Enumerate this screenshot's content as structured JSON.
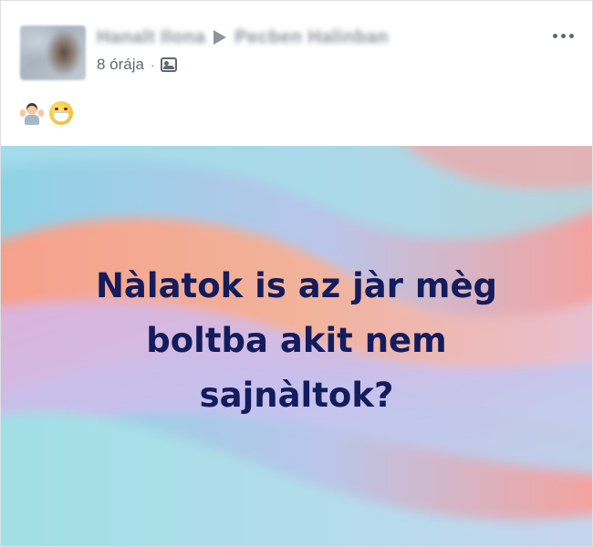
{
  "post": {
    "author_name": "Hanalt Ilona",
    "group_name": "Pecben Halinban",
    "timestamp": "8 órája",
    "separator": "·",
    "privacy_icon": "group-icon",
    "more_icon": "more-icon",
    "text_emojis": [
      "shrug-icon",
      "mask-icon"
    ]
  },
  "image": {
    "lines": [
      "Nàlatok is az jàr mèg",
      "boltba akit nem",
      "sajnàltok?"
    ],
    "text_color": "#131c5c",
    "background_colors": [
      "#8fd7e8",
      "#f6a08e",
      "#d8b6e8",
      "#9ee0e6"
    ]
  }
}
